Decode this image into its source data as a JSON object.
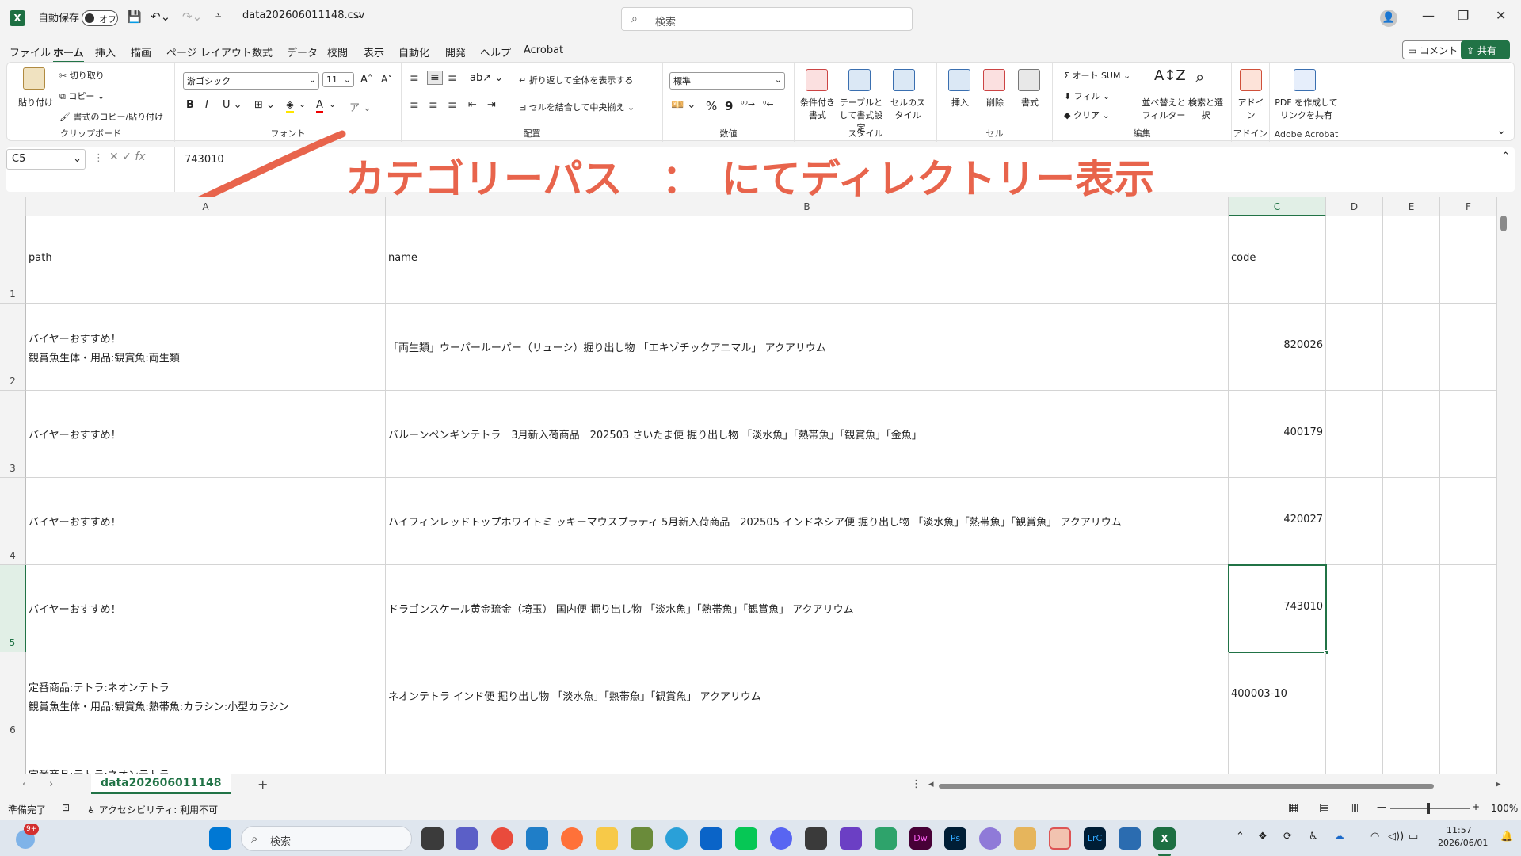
{
  "titlebar": {
    "autosave_label": "自動保存",
    "autosave_state": "オフ",
    "filename": "data202606011148.csv",
    "search_placeholder": "検索"
  },
  "menu": {
    "tabs": [
      "ファイル",
      "ホーム",
      "挿入",
      "描画",
      "ページ レイアウト",
      "数式",
      "データ",
      "校閲",
      "表示",
      "自動化",
      "開発",
      "ヘルプ",
      "Acrobat"
    ],
    "active_index": 1,
    "comment_label": "コメント",
    "share_label": "共有"
  },
  "ribbon": {
    "clipboard": {
      "paste": "貼り付け",
      "cut": "切り取り",
      "copy": "コピー",
      "format_painter": "書式のコピー/貼り付け",
      "group": "クリップボード"
    },
    "font": {
      "font_name": "游ゴシック",
      "font_size": "11",
      "group": "フォント"
    },
    "alignment": {
      "wrap": "折り返して全体を表示する",
      "merge": "セルを結合して中央揃え",
      "group": "配置"
    },
    "number": {
      "format": "標準",
      "group": "数値"
    },
    "styles": {
      "conditional": "条件付き書式",
      "table": "テーブルとして書式設定",
      "cell_styles": "セルのスタイル",
      "group": "スタイル"
    },
    "cells": {
      "insert": "挿入",
      "delete": "削除",
      "format": "書式",
      "group": "セル"
    },
    "editing": {
      "autosum": "オート SUM",
      "fill": "フィル",
      "clear": "クリア",
      "sort": "並べ替えとフィルター",
      "find": "検索と選択",
      "group": "編集"
    },
    "addins": {
      "label": "アドイン",
      "group": "アドイン"
    },
    "acrobat": {
      "label": "PDF を作成してリンクを共有",
      "group": "Adobe Acrobat"
    }
  },
  "formula_bar": {
    "name_box": "C5",
    "fx": "fx",
    "value": "743010"
  },
  "annotation": {
    "text": "カテゴリーパス　：　にてディレクトリー表示",
    "color": "#e8644c"
  },
  "grid": {
    "columns": [
      "A",
      "B",
      "C",
      "D",
      "E",
      "F"
    ],
    "selected_column": "C",
    "selected_row": "5",
    "rows": [
      {
        "num": "1",
        "path": [
          "path"
        ],
        "name": "name",
        "code": "code",
        "code_align": "left"
      },
      {
        "num": "2",
        "path": [
          "バイヤーおすすめ！",
          "観賞魚生体・用品:観賞魚:両生類"
        ],
        "name": "「両生類」ウーパールーパー（リューシ）掘り出し物 「エキゾチックアニマル」 アクアリウム",
        "code": "820026",
        "code_align": "right"
      },
      {
        "num": "3",
        "path": [
          "バイヤーおすすめ！"
        ],
        "name": "バルーンペンギンテトラ　3月新入荷商品　202503 さいたま便 掘り出し物 「淡水魚」「熱帯魚」「観賞魚」「金魚」",
        "code": "400179",
        "code_align": "right"
      },
      {
        "num": "4",
        "path": [
          "バイヤーおすすめ！"
        ],
        "name": "ハイフィンレッドトップホワイトミ ッキーマウスプラティ 5月新入荷商品　202505 インドネシア便 掘り出し物 「淡水魚」「熱帯魚」「観賞魚」 アクアリウム",
        "code": "420027",
        "code_align": "right"
      },
      {
        "num": "5",
        "path": [
          "バイヤーおすすめ！"
        ],
        "name": "ドラゴンスケール黄金琉金（埼玉） 国内便 掘り出し物 「淡水魚」「熱帯魚」「観賞魚」 アクアリウム",
        "code": "743010",
        "code_align": "right"
      },
      {
        "num": "6",
        "path": [
          "定番商品:テトラ:ネオンテトラ",
          "観賞魚生体・用品:観賞魚:熱帯魚:カラシン:小型カラシン"
        ],
        "name": "ネオンテトラ インド便 掘り出し物 「淡水魚」「熱帯魚」「観賞魚」 アクアリウム",
        "code": "400003-10",
        "code_align": "left"
      },
      {
        "num": "",
        "path": [
          "定番商品:テトラ:ネオンテトラ"
        ],
        "name": "",
        "code": "",
        "code_align": "left"
      }
    ]
  },
  "sheet_tabs": {
    "active": "data202606011148",
    "add": "+"
  },
  "status": {
    "ready": "準備完了",
    "accessibility": "アクセシビリティ: 利用不可",
    "zoom": "100%"
  },
  "taskbar": {
    "search": "検索",
    "time": "11:57",
    "date": "2026/06/01",
    "badge": "9+"
  }
}
